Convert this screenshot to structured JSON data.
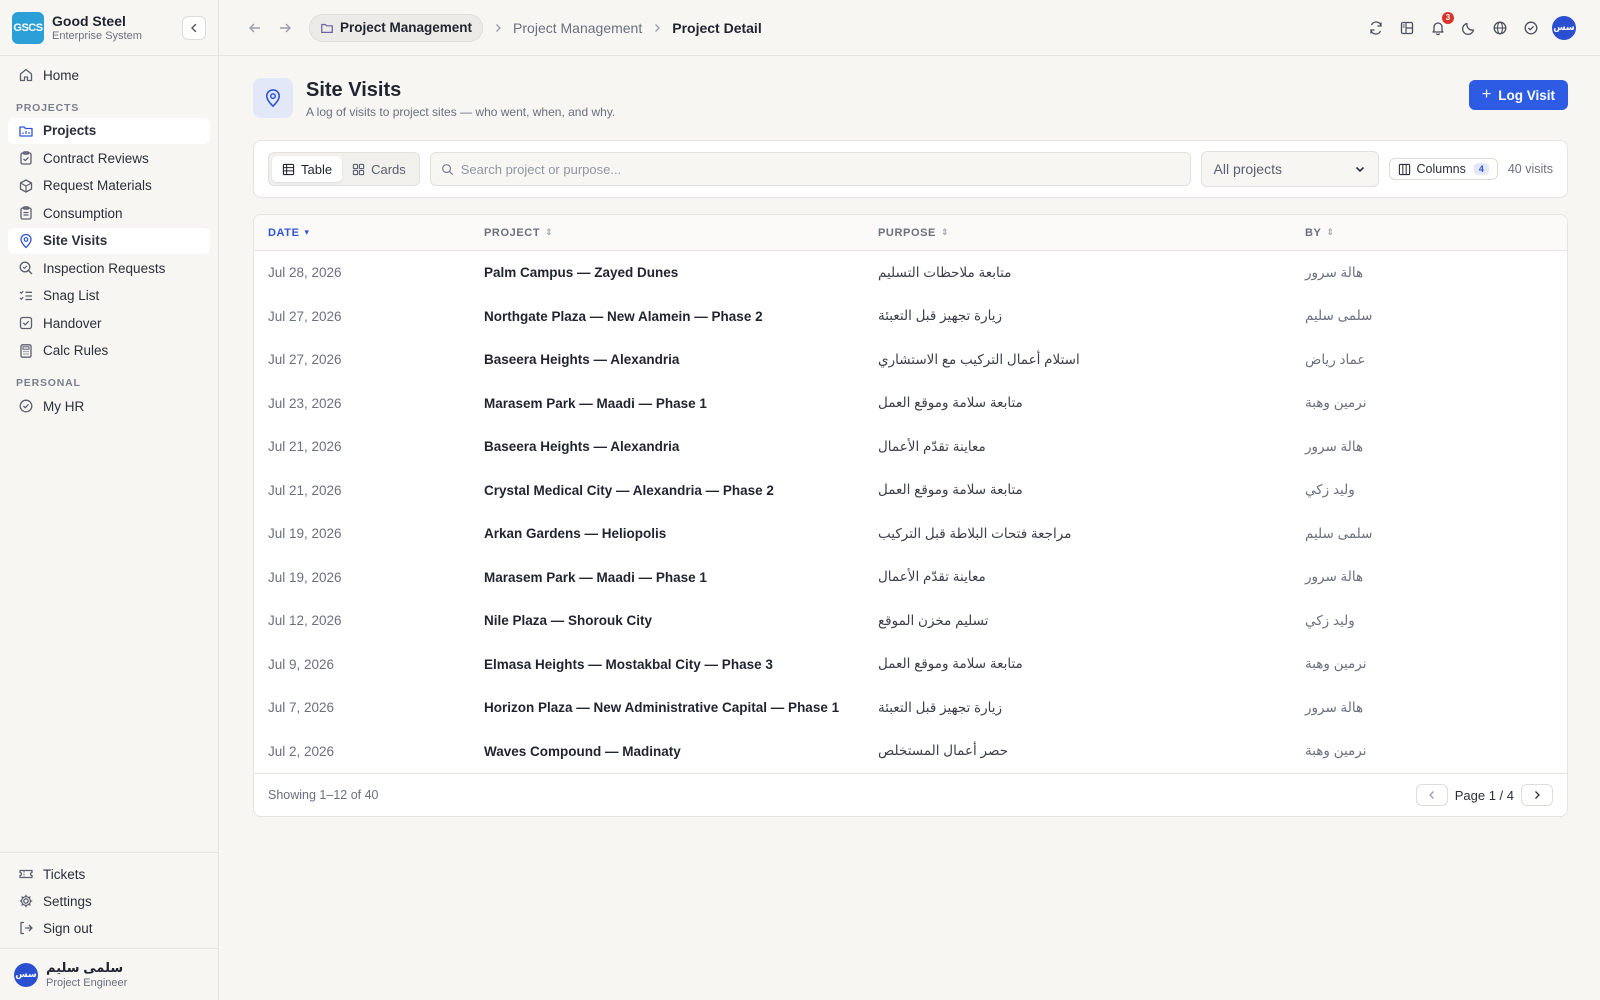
{
  "brand": {
    "logo": "GSCS",
    "name": "Good Steel",
    "subtitle": "Enterprise System"
  },
  "sidebar": {
    "home": {
      "label": "Home",
      "icon": "home-icon"
    },
    "projects_section": "PROJECTS",
    "project_items": [
      {
        "label": "Projects",
        "icon": "folder-icon",
        "active": false
      },
      {
        "label": "Contract Reviews",
        "icon": "clipboard-icon"
      },
      {
        "label": "Request Materials",
        "icon": "boxes-icon"
      },
      {
        "label": "Consumption",
        "icon": "clipboard-list-icon"
      },
      {
        "label": "Site Visits",
        "icon": "map-pin-icon",
        "active": true
      },
      {
        "label": "Inspection Requests",
        "icon": "search-check-icon"
      },
      {
        "label": "Snag List",
        "icon": "list-checks-icon"
      },
      {
        "label": "Handover",
        "icon": "square-check-icon"
      },
      {
        "label": "Calc Rules",
        "icon": "calculator-icon"
      }
    ],
    "personal_section": "PERSONAL",
    "personal_items": [
      {
        "label": "My HR",
        "icon": "circle-check-icon"
      }
    ],
    "bottom_items": [
      {
        "label": "Tickets",
        "icon": "ticket-icon"
      },
      {
        "label": "Settings",
        "icon": "gear-icon"
      },
      {
        "label": "Sign out",
        "icon": "log-out-icon"
      }
    ],
    "user": {
      "initials": "سس",
      "name": "سلمى سليم",
      "role": "Project Engineer"
    }
  },
  "topbar": {
    "crumb_pill": "Project Management",
    "crumbs": [
      "Project Management",
      "Project Detail"
    ],
    "notification_count": "3",
    "avatar_initials": "سس"
  },
  "page": {
    "title": "Site Visits",
    "subtitle": "A log of visits to project sites — who went, when, and why.",
    "log_button": "Log Visit"
  },
  "toolbar": {
    "view_table": "Table",
    "view_cards": "Cards",
    "search_placeholder": "Search project or purpose...",
    "project_filter": "All projects",
    "columns_label": "Columns",
    "columns_count": "4",
    "visits_count": "40 visits"
  },
  "table": {
    "headers": {
      "date": "DATE",
      "project": "PROJECT",
      "purpose": "PURPOSE",
      "by": "BY"
    },
    "rows": [
      {
        "date": "Jul 28, 2026",
        "project": "Palm Campus — Zayed Dunes",
        "purpose": "متابعة ملاحظات التسليم",
        "by": "هالة سرور"
      },
      {
        "date": "Jul 27, 2026",
        "project": "Northgate Plaza — New Alamein — Phase 2",
        "purpose": "زيارة تجهيز قبل التعبئة",
        "by": "سلمى سليم"
      },
      {
        "date": "Jul 27, 2026",
        "project": "Baseera Heights — Alexandria",
        "purpose": "استلام أعمال التركيب مع الاستشاري",
        "by": "عماد رياض"
      },
      {
        "date": "Jul 23, 2026",
        "project": "Marasem Park — Maadi — Phase 1",
        "purpose": "متابعة سلامة وموقع العمل",
        "by": "نرمين وهبة"
      },
      {
        "date": "Jul 21, 2026",
        "project": "Baseera Heights — Alexandria",
        "purpose": "معاينة تقدّم الأعمال",
        "by": "هالة سرور"
      },
      {
        "date": "Jul 21, 2026",
        "project": "Crystal Medical City — Alexandria — Phase 2",
        "purpose": "متابعة سلامة وموقع العمل",
        "by": "وليد زكي"
      },
      {
        "date": "Jul 19, 2026",
        "project": "Arkan Gardens — Heliopolis",
        "purpose": "مراجعة فتحات البلاطة قبل التركيب",
        "by": "سلمى سليم"
      },
      {
        "date": "Jul 19, 2026",
        "project": "Marasem Park — Maadi — Phase 1",
        "purpose": "معاينة تقدّم الأعمال",
        "by": "هالة سرور"
      },
      {
        "date": "Jul 12, 2026",
        "project": "Nile Plaza — Shorouk City",
        "purpose": "تسليم مخزن الموقع",
        "by": "وليد زكي"
      },
      {
        "date": "Jul 9, 2026",
        "project": "Elmasa Heights — Mostakbal City — Phase 3",
        "purpose": "متابعة سلامة وموقع العمل",
        "by": "نرمين وهبة"
      },
      {
        "date": "Jul 7, 2026",
        "project": "Horizon Plaza — New Administrative Capital — Phase 1",
        "purpose": "زيارة تجهيز قبل التعبئة",
        "by": "هالة سرور"
      },
      {
        "date": "Jul 2, 2026",
        "project": "Waves Compound — Madinaty",
        "purpose": "حصر أعمال المستخلص",
        "by": "نرمين وهبة"
      }
    ],
    "showing": "Showing 1–12 of 40",
    "page_label": "Page 1 / 4"
  },
  "colors": {
    "accent": "#2d5be3",
    "brand_logo": "#2a9fd8",
    "badge": "#d9342b"
  }
}
